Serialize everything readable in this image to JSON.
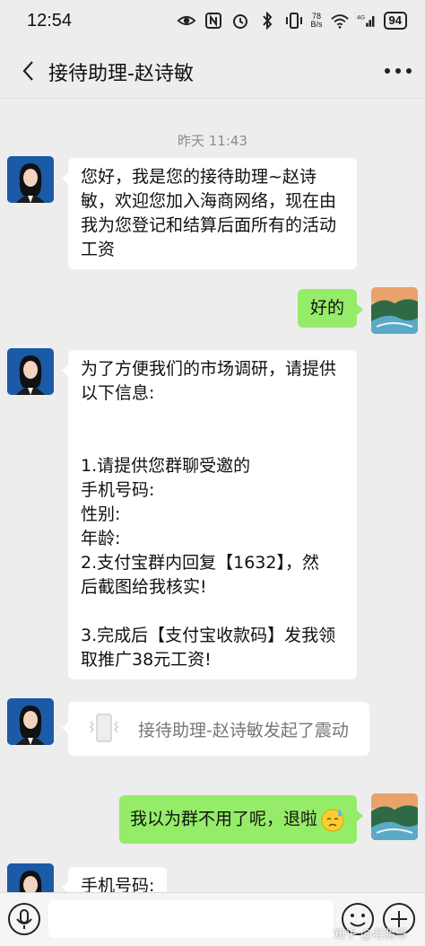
{
  "status_bar": {
    "time": "12:54",
    "net_speed_top": "78",
    "net_speed_bottom": "B/s",
    "network": "4G",
    "battery": "94"
  },
  "header": {
    "title": "接待助理-赵诗敏"
  },
  "chat": {
    "timestamp": "昨天 11:43",
    "msg1": {
      "lines": [
        "您好，我是您的接待助理~赵诗",
        "敏，欢迎您加入海商网络，现在由",
        "我为您登记和结算后面所有的活动",
        "工资"
      ]
    },
    "msg2": {
      "text": "好的"
    },
    "msg3": {
      "lines": [
        "为了方便我们的市场调研，请提供",
        "以下信息:",
        "",
        "",
        "1.请提供您群聊受邀的",
        "手机号码:",
        "性别:",
        "年龄:",
        "2.支付宝群内回复【1632】，然",
        "后截图给我核实!",
        "",
        "3.完成后【支付宝收款码】发我领",
        "取推广38元工资!"
      ]
    },
    "shake": {
      "text": "接待助理-赵诗敏发起了震动"
    },
    "msg4": {
      "text": "我以为群不用了呢，退啦"
    },
    "msg5": {
      "text": "手机号码:"
    }
  },
  "watermark": "知乎 @老腊哥",
  "colors": {
    "background": "#ededed",
    "bubble_out": "#95ec69",
    "bubble_in": "#ffffff"
  }
}
